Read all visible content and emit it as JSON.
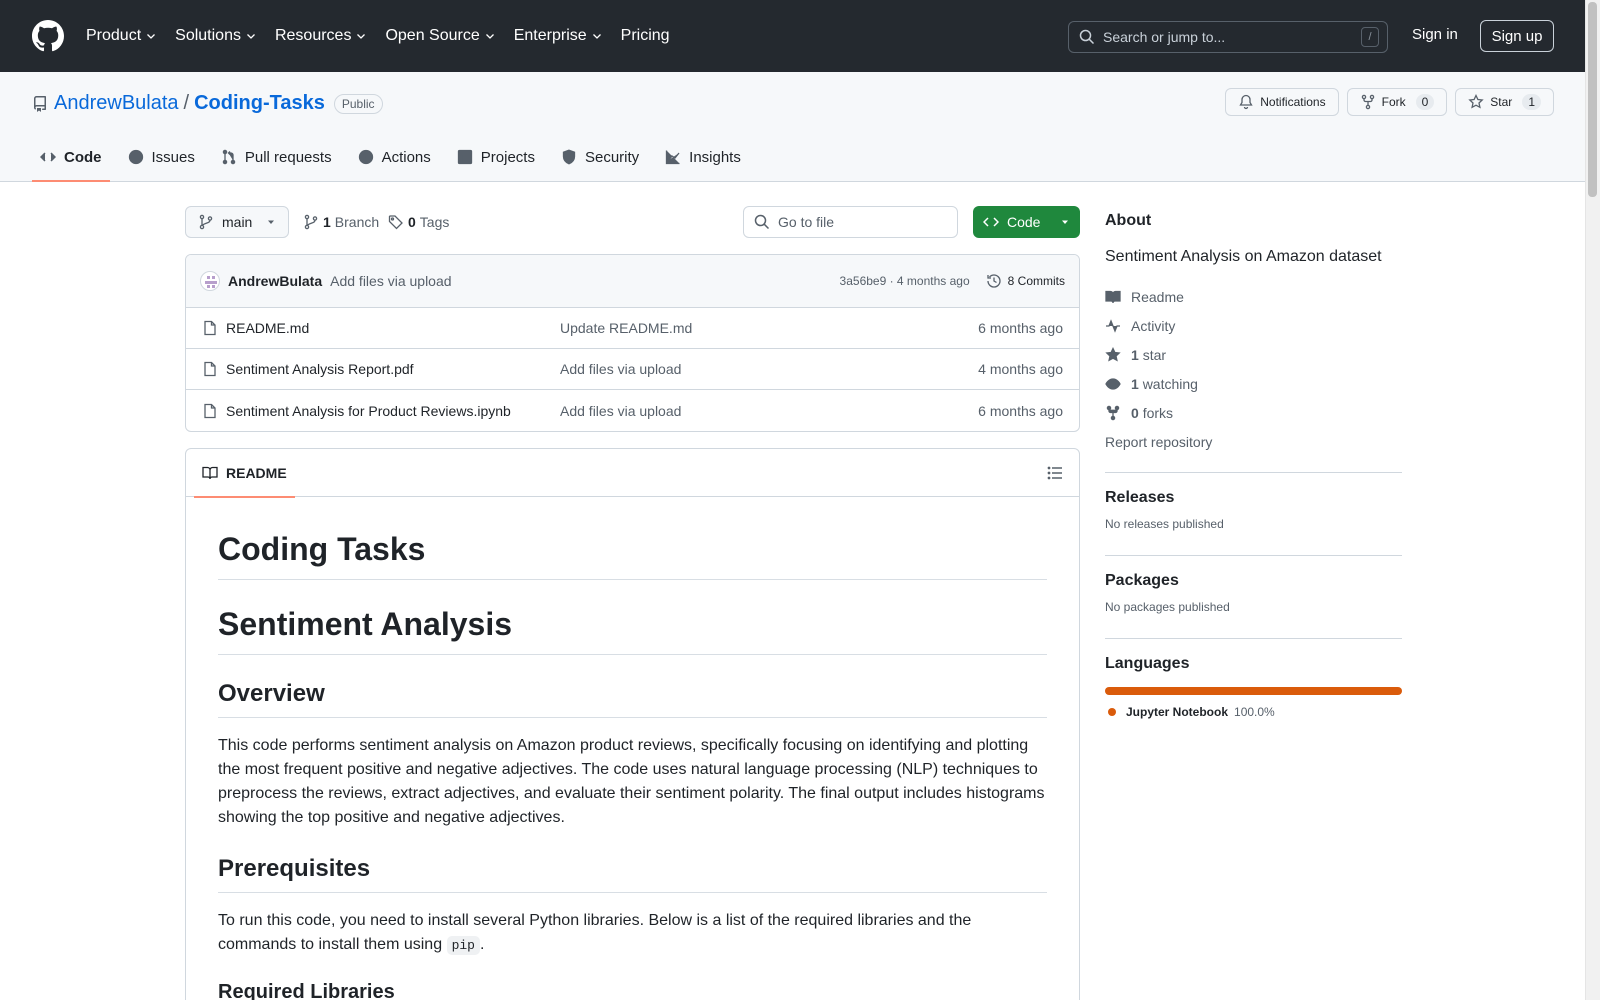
{
  "header": {
    "nav": [
      "Product",
      "Solutions",
      "Resources",
      "Open Source",
      "Enterprise",
      "Pricing"
    ],
    "search_placeholder": "Search or jump to...",
    "search_shortcut": "/",
    "sign_in": "Sign in",
    "sign_up": "Sign up"
  },
  "repo": {
    "owner": "AndrewBulata",
    "separator": "/",
    "name": "Coding-Tasks",
    "visibility": "Public",
    "notifications_label": "Notifications",
    "fork_label": "Fork",
    "fork_count": "0",
    "star_label": "Star",
    "star_count": "1"
  },
  "tabs": [
    "Code",
    "Issues",
    "Pull requests",
    "Actions",
    "Projects",
    "Security",
    "Insights"
  ],
  "toolbar": {
    "branch": "main",
    "branch_count": "1",
    "branch_label": "Branch",
    "tag_count": "0",
    "tag_label": "Tags",
    "goto_placeholder": "Go to file",
    "code_button": "Code"
  },
  "commit": {
    "author": "AndrewBulata",
    "message": "Add files via upload",
    "hash_time": "3a56be9 · 4 months ago",
    "commits": "8 Commits"
  },
  "files": [
    {
      "name": "README.md",
      "message": "Update README.md",
      "date": "6 months ago"
    },
    {
      "name": "Sentiment Analysis Report.pdf",
      "message": "Add files via upload",
      "date": "4 months ago"
    },
    {
      "name": "Sentiment Analysis for Product Reviews.ipynb",
      "message": "Add files via upload",
      "date": "6 months ago"
    }
  ],
  "readme": {
    "tab": "README",
    "h1": "Coding Tasks",
    "h1b": "Sentiment Analysis",
    "overview_h": "Overview",
    "overview_p": "This code performs sentiment analysis on Amazon product reviews, specifically focusing on identifying and plotting the most frequent positive and negative adjectives. The code uses natural language processing (NLP) techniques to preprocess the reviews, extract adjectives, and evaluate their sentiment polarity. The final output includes histograms showing the top positive and negative adjectives.",
    "prereq_h": "Prerequisites",
    "prereq_p": "To run this code, you need to install several Python libraries. Below is a list of the required libraries and the commands to install them using",
    "prereq_code": "pip",
    "prereq_end": ".",
    "required_h": "Required Libraries"
  },
  "about": {
    "title": "About",
    "description": "Sentiment Analysis on Amazon dataset",
    "readme": "Readme",
    "activity": "Activity",
    "stars_count": "1",
    "stars_label": "star",
    "watching_count": "1",
    "watching_label": "watching",
    "forks_count": "0",
    "forks_label": "forks",
    "report": "Report repository"
  },
  "releases": {
    "title": "Releases",
    "text": "No releases published"
  },
  "packages": {
    "title": "Packages",
    "text": "No packages published"
  },
  "languages": {
    "title": "Languages",
    "name": "Jupyter Notebook",
    "percent": "100.0%",
    "color": "#da5b0b",
    "share": 1.0
  }
}
